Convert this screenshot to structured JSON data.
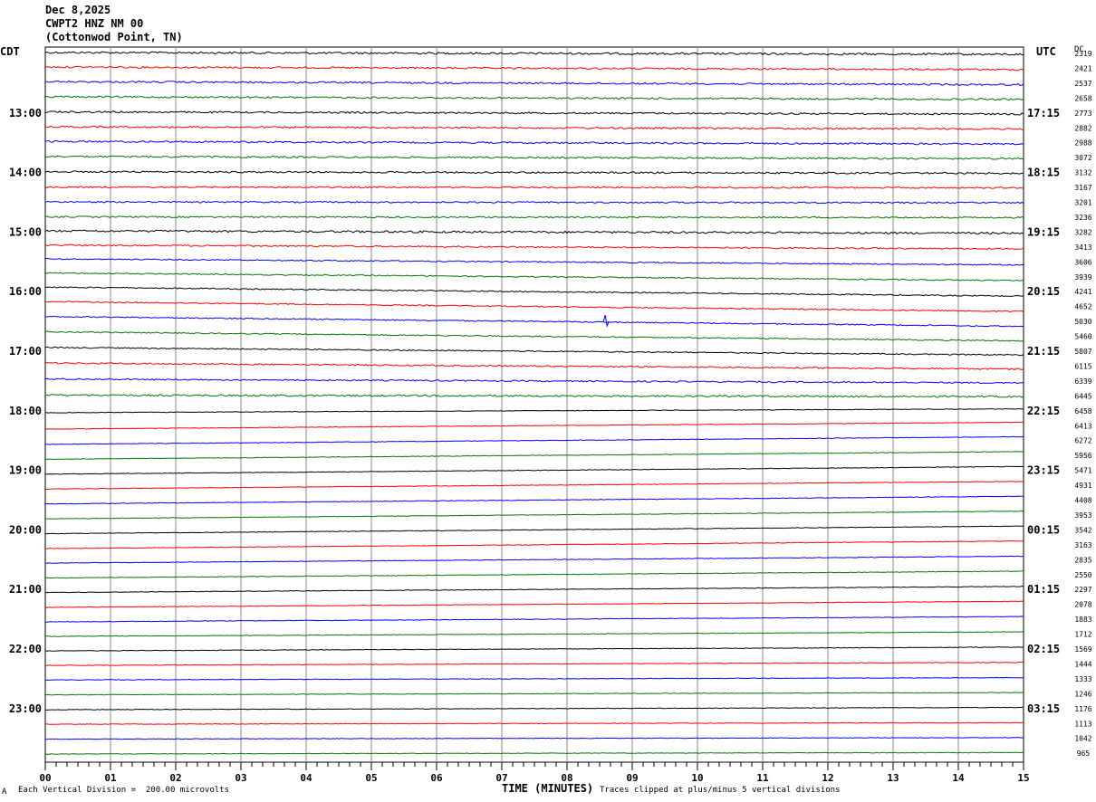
{
  "header": {
    "date": "Dec 8,2025",
    "station": "CWPT2 HNZ NM 00",
    "location": "(Cottonwod Point, TN)"
  },
  "left_timezone": "CDT",
  "right_timezone": "UTC",
  "dc_label": "DC",
  "footer": {
    "scale_note": "Each Vertical Division =  200.00 microvolts",
    "clip_note": "Traces clipped at plus/minus 5 vertical divisions",
    "corner_mark": "A"
  },
  "colors": {
    "black": "#000000",
    "red": "#ff0000",
    "blue": "#0000ff",
    "green": "#007700",
    "grid": "#888888"
  },
  "chart_data": {
    "type": "line",
    "title": "CWPT2 HNZ NM 00",
    "xlabel": "TIME (MINUTES)",
    "x_ticks": [
      "00",
      "01",
      "02",
      "03",
      "04",
      "05",
      "06",
      "07",
      "08",
      "09",
      "10",
      "11",
      "12",
      "13",
      "14",
      "15"
    ],
    "xlim": [
      0,
      15
    ],
    "left_hour_labels": [
      "13:00",
      "14:00",
      "15:00",
      "16:00",
      "17:00",
      "18:00",
      "19:00",
      "20:00",
      "21:00",
      "22:00",
      "23:00"
    ],
    "right_hour_labels": [
      "17:15",
      "18:15",
      "19:15",
      "20:15",
      "21:15",
      "22:15",
      "23:15",
      "00:15",
      "01:15",
      "02:15",
      "03:15"
    ],
    "trace_colors": [
      "black",
      "red",
      "blue",
      "green"
    ],
    "dc_values": [
      2319,
      2421,
      2537,
      2658,
      2773,
      2882,
      2988,
      3072,
      3132,
      3167,
      3201,
      3236,
      3282,
      3413,
      3606,
      3939,
      4241,
      4652,
      5030,
      5460,
      5807,
      6115,
      6339,
      6445,
      6458,
      6413,
      6272,
      5956,
      5471,
      4931,
      4408,
      3953,
      3542,
      3163,
      2835,
      2550,
      2297,
      2078,
      1883,
      1712,
      1569,
      1444,
      1333,
      1246,
      1176,
      1113,
      1042,
      965
    ],
    "trace_drift": [
      0.25,
      0.35,
      0.4,
      0.35,
      0.3,
      0.3,
      0.35,
      0.3,
      0.2,
      0.1,
      0.1,
      0.1,
      0.3,
      0.5,
      0.8,
      1.0,
      1.2,
      1.3,
      1.3,
      1.2,
      1.0,
      0.8,
      0.5,
      0.2,
      -0.5,
      -0.9,
      -1.0,
      -1.0,
      -1.0,
      -1.0,
      -1.0,
      -1.0,
      -1.0,
      -1.0,
      -0.9,
      -0.9,
      -0.8,
      -0.8,
      -0.7,
      -0.6,
      -0.5,
      -0.4,
      -0.3,
      -0.3,
      -0.3,
      -0.2,
      -0.2,
      -0.2
    ],
    "trace_noise": [
      0.35,
      0.3,
      0.3,
      0.3,
      0.3,
      0.3,
      0.3,
      0.3,
      0.3,
      0.25,
      0.25,
      0.25,
      0.35,
      0.25,
      0.2,
      0.2,
      0.2,
      0.2,
      0.2,
      0.2,
      0.2,
      0.25,
      0.25,
      0.3,
      0.1,
      0.1,
      0.1,
      0.1,
      0.1,
      0.1,
      0.1,
      0.1,
      0.1,
      0.1,
      0.1,
      0.1,
      0.1,
      0.1,
      0.1,
      0.1,
      0.1,
      0.1,
      0.1,
      0.1,
      0.1,
      0.1,
      0.1,
      0.1
    ]
  }
}
